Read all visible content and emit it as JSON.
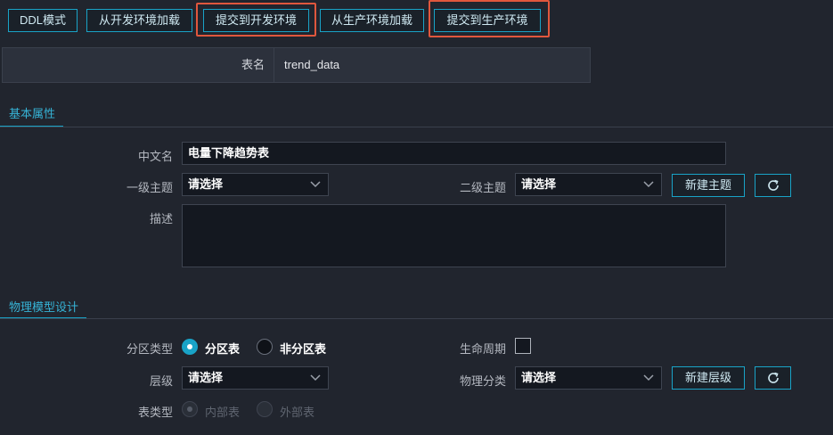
{
  "toolbar": {
    "ddl_label": "DDL模式",
    "load_dev_label": "从开发环境加载",
    "submit_dev_label": "提交到开发环境",
    "load_prod_label": "从生产环境加载",
    "submit_prod_label": "提交到生产环境"
  },
  "table_name": {
    "label": "表名",
    "value": "trend_data"
  },
  "basic_section": {
    "title": "基本属性",
    "chinese_name_label": "中文名",
    "chinese_name_value": "电量下降趋势表",
    "level1_topic_label": "一级主题",
    "level1_topic_value": "请选择",
    "level2_topic_label": "二级主题",
    "level2_topic_value": "请选择",
    "new_topic_label": "新建主题",
    "description_label": "描述"
  },
  "physical_section": {
    "title": "物理模型设计",
    "partition_type_label": "分区类型",
    "partition_option": "分区表",
    "non_partition_option": "非分区表",
    "partition_selected": "分区表",
    "lifecycle_label": "生命周期",
    "layer_label": "层级",
    "layer_value": "请选择",
    "physical_category_label": "物理分类",
    "physical_category_value": "请选择",
    "new_layer_label": "新建层级",
    "table_type_label": "表类型",
    "internal_option": "内部表",
    "external_option": "外部表"
  },
  "colors": {
    "accent": "#19a3c7",
    "highlight_border": "#e0573d",
    "background": "#21252e"
  },
  "icons": {
    "refresh": "refresh-icon",
    "dropdown": "chevron-down-icon"
  }
}
